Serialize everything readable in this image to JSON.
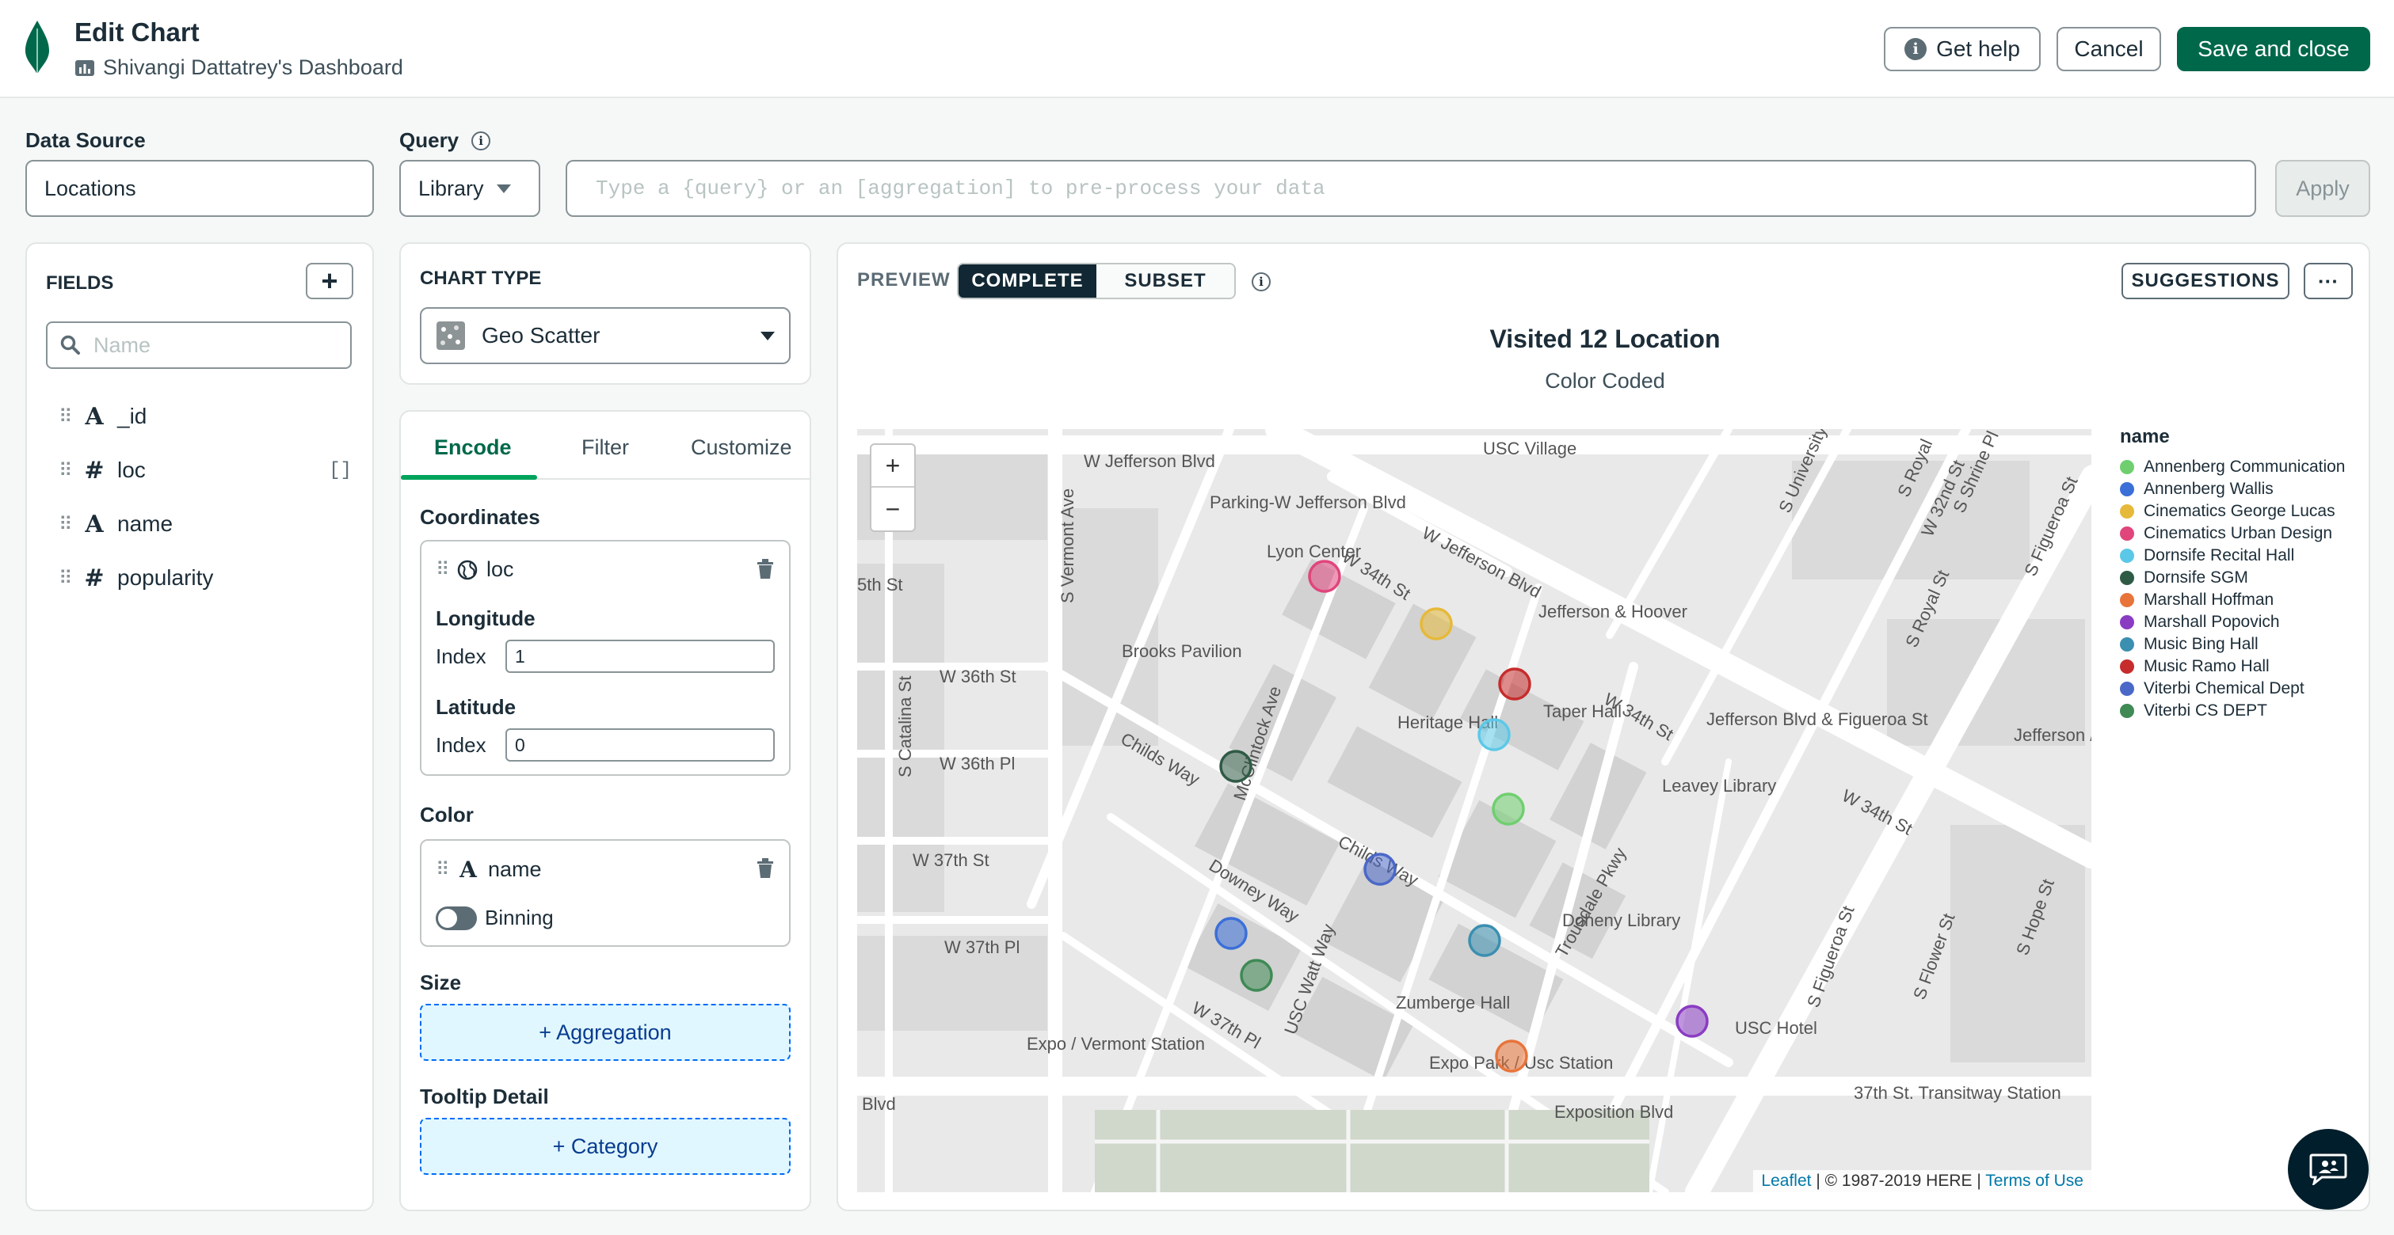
{
  "header": {
    "title": "Edit Chart",
    "dashboard": "Shivangi Dattatrey's Dashboard",
    "help_label": "Get help",
    "cancel_label": "Cancel",
    "save_label": "Save and close"
  },
  "toolbar": {
    "data_source_label": "Data Source",
    "data_source_value": "Locations",
    "query_label": "Query",
    "library_label": "Library",
    "query_placeholder": "Type a {query} or an [aggregation] to pre-process your data",
    "apply_label": "Apply"
  },
  "fields": {
    "title": "FIELDS",
    "search_placeholder": "Name",
    "items": [
      {
        "type": "A",
        "name": "_id",
        "extra": ""
      },
      {
        "type": "#",
        "name": "loc",
        "extra": "[]"
      },
      {
        "type": "A",
        "name": "name",
        "extra": ""
      },
      {
        "type": "#",
        "name": "popularity",
        "extra": ""
      }
    ]
  },
  "chart_type": {
    "label": "CHART TYPE",
    "value": "Geo Scatter"
  },
  "encode": {
    "tabs": [
      "Encode",
      "Filter",
      "Customize"
    ],
    "active_tab": "Encode",
    "coordinates_label": "Coordinates",
    "coord_field": "loc",
    "longitude_label": "Longitude",
    "latitude_label": "Latitude",
    "index_label": "Index",
    "longitude_index": "1",
    "latitude_index": "0",
    "color_label": "Color",
    "color_field": "name",
    "binning_label": "Binning",
    "size_label": "Size",
    "size_button": "+ Aggregation",
    "tooltip_label": "Tooltip Detail",
    "tooltip_button": "+ Category"
  },
  "preview": {
    "label": "PREVIEW",
    "complete_label": "COMPLETE",
    "subset_label": "SUBSET",
    "suggestions_label": "SUGGESTIONS",
    "more_label": "···",
    "chart_title": "Visited 12 Location",
    "chart_subtitle": "Color Coded",
    "zoom_in": "+",
    "zoom_out": "−",
    "attribution_leaflet": "Leaflet",
    "attribution_text": "| © 1987-2019 HERE |",
    "attribution_terms": "Terms of Use"
  },
  "map_labels": [
    "W Jefferson Blvd",
    "USC Village",
    "Parking-W Jefferson Blvd",
    "Lyon Center",
    "W 34th St",
    "W Jefferson Blvd",
    "Jefferson & Hoover",
    "S Vermont Ave",
    "5th St",
    "Brooks Pavilion",
    "W 36th St",
    "S Catalina St",
    "Childs Way",
    "Heritage Hall",
    "Taper Hall",
    "W 34th St",
    "Jefferson Blvd & Figueroa St",
    "Leavey Library",
    "W 36th Pl",
    "McClintock Ave",
    "W 37th St",
    "Downey Way",
    "Childs Way",
    "Trousdale Pkwy",
    "Doheny Library",
    "W 37th Pl",
    "USC Watt Way",
    "Zumberge Hall",
    "Expo / Vermont Station",
    "Expo Park / Usc Station",
    "USC Hotel",
    "37th St. Transitway Station",
    "Blvd",
    "Exposition Blvd",
    "Jefferson / Usc Station",
    "S Figueroa St",
    "S Flower St",
    "S Hope St",
    "W 34th St",
    "S University Av",
    "S Royal",
    "S Shrine Pl",
    "W 32nd St",
    "S Figueroa St",
    "S Royal St",
    "W 37th Pl"
  ],
  "chart_data": {
    "type": "scatter",
    "title": "Visited 12 Location",
    "subtitle": "Color Coded",
    "legend_title": "name",
    "legend_position": "right",
    "series": [
      {
        "name": "Annenberg Communication",
        "color": "#6fcf6f"
      },
      {
        "name": "Annenberg Wallis",
        "color": "#3b6fd8"
      },
      {
        "name": "Cinematics George Lucas",
        "color": "#e6b93a"
      },
      {
        "name": "Cinematics Urban Design",
        "color": "#e0457b"
      },
      {
        "name": "Dornsife Recital Hall",
        "color": "#5cc8e8"
      },
      {
        "name": "Dornsife SGM",
        "color": "#2f5a46"
      },
      {
        "name": "Marshall Hoffman",
        "color": "#e8743a"
      },
      {
        "name": "Marshall Popovich",
        "color": "#8a3cc2"
      },
      {
        "name": "Music Bing Hall",
        "color": "#3b8fb0"
      },
      {
        "name": "Music Ramo Hall",
        "color": "#c62c2c"
      },
      {
        "name": "Viterbi Chemical Dept",
        "color": "#4a68c8"
      },
      {
        "name": "Viterbi CS DEPT",
        "color": "#3f8a55"
      }
    ]
  }
}
